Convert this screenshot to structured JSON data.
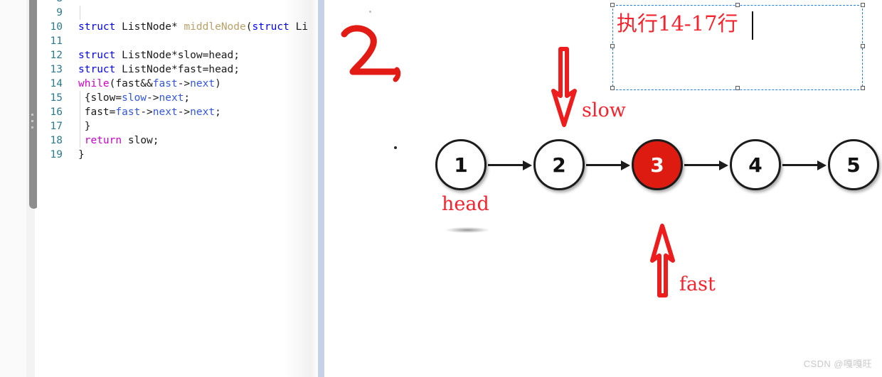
{
  "editor": {
    "language": "c",
    "scrollbar_present": true,
    "lines": [
      {
        "number": "8",
        "tokens": []
      },
      {
        "number": "9",
        "tokens": []
      },
      {
        "number": "10",
        "tokens": [
          {
            "t": "struct",
            "c": "kw"
          },
          {
            "t": " ",
            "c": "plain"
          },
          {
            "t": "ListNode*",
            "c": "plain"
          },
          {
            "t": " ",
            "c": "plain"
          },
          {
            "t": "middleNode",
            "c": "fn"
          },
          {
            "t": "(",
            "c": "plain"
          },
          {
            "t": "struct",
            "c": "kw"
          },
          {
            "t": " Li",
            "c": "plain"
          }
        ]
      },
      {
        "number": "11",
        "tokens": []
      },
      {
        "number": "12",
        "tokens": [
          {
            "t": "struct",
            "c": "kw"
          },
          {
            "t": " ",
            "c": "plain"
          },
          {
            "t": "ListNode*slow=head;",
            "c": "plain"
          }
        ]
      },
      {
        "number": "13",
        "tokens": [
          {
            "t": "struct",
            "c": "kw"
          },
          {
            "t": " ",
            "c": "plain"
          },
          {
            "t": "ListNode*fast=head;",
            "c": "plain"
          }
        ]
      },
      {
        "number": "14",
        "tokens": [
          {
            "t": "while",
            "c": "kwm"
          },
          {
            "t": "(fast&&",
            "c": "plain"
          },
          {
            "t": "fast",
            "c": "var"
          },
          {
            "t": "->",
            "c": "plain"
          },
          {
            "t": "next",
            "c": "var"
          },
          {
            "t": ")",
            "c": "plain"
          }
        ]
      },
      {
        "number": "15",
        "tokens": [
          {
            "t": " {slow=",
            "c": "plain"
          },
          {
            "t": "slow",
            "c": "var"
          },
          {
            "t": "->",
            "c": "plain"
          },
          {
            "t": "next",
            "c": "var"
          },
          {
            "t": ";",
            "c": "plain"
          }
        ]
      },
      {
        "number": "16",
        "tokens": [
          {
            "t": " fast=",
            "c": "plain"
          },
          {
            "t": "fast",
            "c": "var"
          },
          {
            "t": "->",
            "c": "plain"
          },
          {
            "t": "next",
            "c": "var"
          },
          {
            "t": "->",
            "c": "plain"
          },
          {
            "t": "next",
            "c": "var"
          },
          {
            "t": ";",
            "c": "plain"
          }
        ]
      },
      {
        "number": "17",
        "tokens": [
          {
            "t": " }",
            "c": "plain"
          }
        ]
      },
      {
        "number": "18",
        "tokens": [
          {
            "t": " ",
            "c": "plain"
          },
          {
            "t": "return",
            "c": "kwm"
          },
          {
            "t": " slow;",
            "c": "plain"
          }
        ]
      },
      {
        "number": "19",
        "tokens": [
          {
            "t": "}",
            "c": "plain"
          }
        ]
      }
    ]
  },
  "annotation": {
    "text": "执行14-17行",
    "color": "#f4232e",
    "border_color": "#1f7fe0",
    "selected": true,
    "caret_visible": true
  },
  "mark": {
    "label": "2,",
    "color": "#e21b14"
  },
  "diagram": {
    "nodes": [
      {
        "value": "1",
        "highlighted": false
      },
      {
        "value": "2",
        "highlighted": false
      },
      {
        "value": "3",
        "highlighted": true
      },
      {
        "value": "4",
        "highlighted": false
      },
      {
        "value": "5",
        "highlighted": false
      }
    ],
    "highlight_color": "#dd1b10",
    "node_border_color": "#1c1c1c",
    "labels": {
      "head": "head",
      "slow": "slow",
      "fast": "fast"
    },
    "pointer_color": "#ee1d1d",
    "slow_points_to": "2",
    "fast_points_to": "3",
    "head_points_to": "1"
  },
  "watermark": {
    "text": "CSDN @嘎嘎旺"
  }
}
